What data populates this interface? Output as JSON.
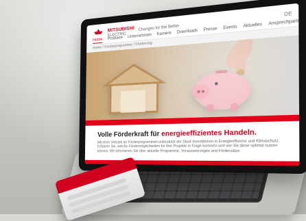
{
  "site": {
    "brand_name": "MITSUBISHI",
    "brand_sub": "ELECTRIC",
    "slogan": "Changes for the Better",
    "lang": "DE"
  },
  "nav": {
    "items": [
      {
        "label": "Home"
      },
      {
        "label": "Produkte"
      },
      {
        "label": "Unternehmen"
      },
      {
        "label": "Karriere"
      },
      {
        "label": "Downloads"
      },
      {
        "label": "Presse"
      },
      {
        "label": "Events"
      },
      {
        "label": "Aktuelles"
      },
      {
        "label": "Ansprechpartner"
      },
      {
        "label": "Kontakt"
      }
    ],
    "active_index": 0
  },
  "breadcrumb": "Home / Förderprogramme / Förderung",
  "hero": {
    "headline_prefix": "Volle Förderkraft für",
    "headline_highlight": "energieeffizientes Handeln.",
    "paragraph": "Mit einer Vielzahl an Förderprogrammen unterstützt der Staat Investitionen in Energieeffizienz und Klimaschutz. Erfahren Sie, welche Fördermöglichkeiten für Ihre Projekte in Frage kommen und wie Sie diese optimal nutzen können. Wir informieren Sie über aktuelle Programme, Voraussetzungen und Fördersätze."
  },
  "colors": {
    "brand_red": "#d1001f",
    "red_band": "#e1001a"
  }
}
